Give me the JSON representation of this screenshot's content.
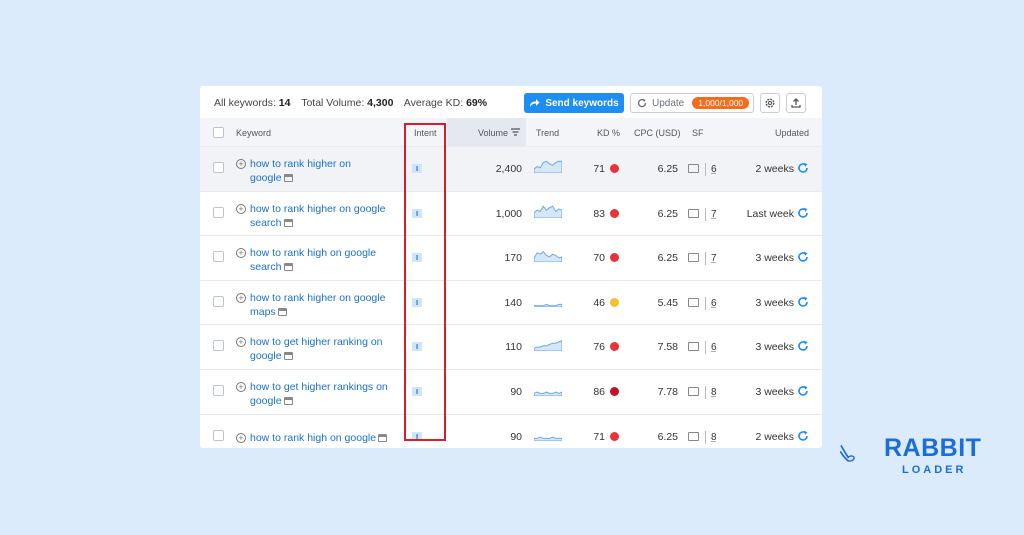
{
  "summary": {
    "all_keywords_label": "All keywords:",
    "all_keywords_value": "14",
    "total_volume_label": "Total Volume:",
    "total_volume_value": "4,300",
    "avg_kd_label": "Average KD:",
    "avg_kd_value": "69%"
  },
  "toolbar": {
    "send_label": "Send keywords",
    "update_label": "Update",
    "update_badge": "1,000/1,000"
  },
  "columns": {
    "keyword": "Keyword",
    "intent": "Intent",
    "volume": "Volume",
    "trend": "Trend",
    "kd": "KD %",
    "cpc": "CPC (USD)",
    "sf": "SF",
    "updated": "Updated"
  },
  "colors": {
    "accent": "#1f8ef1",
    "badge": "#f76b1c",
    "highlight_box": "#d2202f",
    "kd_red": "#e8333a",
    "kd_darkred": "#c4102a",
    "kd_yellow": "#f5c12e"
  },
  "rows": [
    {
      "kw1": "how to rank higher on",
      "kw2": "google",
      "intent": "I",
      "volume": "2,400",
      "kd": "71",
      "kd_color": "#e8333a",
      "cpc": "6.25",
      "sf": "6",
      "updated": "2 weeks",
      "trend": [
        3,
        5,
        4,
        8,
        9,
        7,
        6,
        8,
        9,
        9
      ]
    },
    {
      "kw1": "how to rank higher on google",
      "kw2": "search",
      "intent": "I",
      "volume": "1,000",
      "kd": "83",
      "kd_color": "#e8333a",
      "cpc": "6.25",
      "sf": "7",
      "updated": "Last week",
      "trend": [
        4,
        6,
        5,
        9,
        6,
        8,
        9,
        5,
        7,
        6
      ]
    },
    {
      "kw1": "how to rank high on google",
      "kw2": "search",
      "intent": "I",
      "volume": "170",
      "kd": "70",
      "kd_color": "#e8333a",
      "cpc": "6.25",
      "sf": "7",
      "updated": "3 weeks",
      "trend": [
        3,
        7,
        6,
        8,
        5,
        4,
        6,
        5,
        3,
        4
      ]
    },
    {
      "kw1": "how to rank higher on google",
      "kw2": "maps",
      "intent": "I",
      "volume": "140",
      "kd": "46",
      "kd_color": "#f5c12e",
      "cpc": "5.45",
      "sf": "6",
      "updated": "3 weeks",
      "trend": [
        1,
        1,
        1,
        1,
        2,
        1,
        1,
        1,
        2,
        2
      ]
    },
    {
      "kw1": "how to get higher ranking on",
      "kw2": "google",
      "intent": "I",
      "volume": "110",
      "kd": "76",
      "kd_color": "#e8333a",
      "cpc": "7.58",
      "sf": "6",
      "updated": "3 weeks",
      "trend": [
        2,
        3,
        3,
        4,
        4,
        5,
        6,
        6,
        7,
        8
      ]
    },
    {
      "kw1": "how to get higher rankings on",
      "kw2": "google",
      "intent": "I",
      "volume": "90",
      "kd": "86",
      "kd_color": "#c4102a",
      "cpc": "7.78",
      "sf": "8",
      "updated": "3 weeks",
      "trend": [
        2,
        3,
        2,
        2,
        3,
        2,
        2,
        3,
        2,
        3
      ]
    },
    {
      "kw1": "how to rank high on google",
      "kw2": "",
      "intent": "I",
      "volume": "90",
      "kd": "71",
      "kd_color": "#e8333a",
      "cpc": "6.25",
      "sf": "8",
      "updated": "2 weeks",
      "trend": [
        2,
        2,
        3,
        2,
        2,
        2,
        3,
        2,
        2,
        2
      ]
    }
  ],
  "brand": {
    "line1": "RABBIT",
    "line2": "LOADER",
    "icon": "rabbit-ears-icon"
  }
}
